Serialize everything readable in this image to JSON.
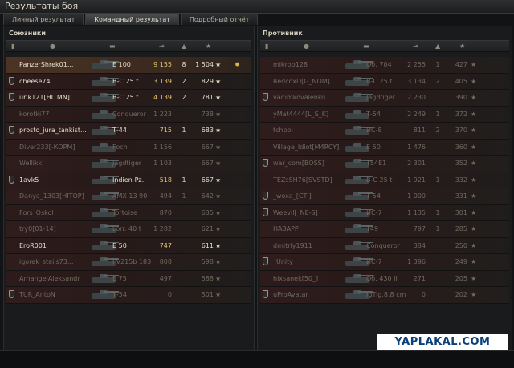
{
  "window": {
    "title": "Результаты боя"
  },
  "tabs": [
    {
      "label": "Личный результат",
      "active": false
    },
    {
      "label": "Командный результат",
      "active": true
    },
    {
      "label": "Подробный отчёт",
      "active": false
    }
  ],
  "allies": {
    "title": "Союзники",
    "columns": {
      "platoon": "platoon-icon",
      "player": "player-icon",
      "tank": "tank-icon",
      "damage": "damage-icon",
      "frags": "frags-icon",
      "xp": "★"
    },
    "rows": [
      {
        "player": "PanzerShrek01...",
        "tank": "E 100",
        "damage": "9 155",
        "frags": "8",
        "xp": "1 504",
        "alive": true,
        "platoon": false,
        "highlight": true,
        "medal": true
      },
      {
        "player": "cheese74",
        "tank": "В-С 25 t",
        "damage": "3 139",
        "frags": "2",
        "xp": "829",
        "alive": true,
        "platoon": true
      },
      {
        "player": "urik121[HITMN]",
        "tank": "В-С 25 t",
        "damage": "4 139",
        "frags": "2",
        "xp": "781",
        "alive": true,
        "platoon": true
      },
      {
        "player": "korotki77",
        "tank": "Conqueror",
        "damage": "1 223",
        "frags": "",
        "xp": "738",
        "alive": false,
        "platoon": false
      },
      {
        "player": "prosto_jura_tankist...",
        "tank": "Т-44",
        "damage": "715",
        "frags": "1",
        "xp": "683",
        "alive": true,
        "platoon": true
      },
      {
        "player": "Diver233[-КОРМ]",
        "tank": "Foch",
        "damage": "1 156",
        "frags": "",
        "xp": "667",
        "alive": false,
        "platoon": false
      },
      {
        "player": "Wellikk",
        "tank": "Jagdtiger",
        "damage": "1 103",
        "frags": "",
        "xp": "667",
        "alive": false,
        "platoon": false
      },
      {
        "player": "1avk5",
        "tank": "Indien-Pz.",
        "damage": "518",
        "frags": "1",
        "xp": "667",
        "alive": true,
        "platoon": true
      },
      {
        "player": "Danya_1303[HITOP]",
        "tank": "AMX 13 90",
        "damage": "494",
        "frags": "1",
        "xp": "642",
        "alive": false,
        "platoon": false
      },
      {
        "player": "Fors_Oskol",
        "tank": "Tortoise",
        "damage": "870",
        "frags": "",
        "xp": "635",
        "alive": false,
        "platoon": false
      },
      {
        "player": "try0[01-14]",
        "tank": "Lorr. 40 t",
        "damage": "1 282",
        "frags": "",
        "xp": "621",
        "alive": false,
        "platoon": false
      },
      {
        "player": "EroR001",
        "tank": "E 50",
        "damage": "747",
        "frags": "",
        "xp": "611",
        "alive": true,
        "platoon": false
      },
      {
        "player": "igorek_stails73...",
        "tank": "FV215b 183",
        "damage": "808",
        "frags": "",
        "xp": "598",
        "alive": false,
        "platoon": false
      },
      {
        "player": "ArhangelAleksandr",
        "tank": "E 75",
        "damage": "497",
        "frags": "",
        "xp": "588",
        "alive": false,
        "platoon": false
      },
      {
        "player": "TUR_AntoN",
        "tank": "Т-54",
        "damage": "0",
        "frags": "",
        "xp": "501",
        "alive": false,
        "platoon": true
      }
    ]
  },
  "enemies": {
    "title": "Противник",
    "rows": [
      {
        "player": "mikrob128",
        "tank": "Об. 704",
        "damage": "2 255",
        "frags": "1",
        "xp": "427",
        "alive": false,
        "platoon": false
      },
      {
        "player": "RedcoxD[G_NOM]",
        "tank": "В-С 25 t",
        "damage": "3 134",
        "frags": "2",
        "xp": "405",
        "alive": false,
        "platoon": false
      },
      {
        "player": "vadimkovalenko",
        "tank": "Jagdtiger",
        "damage": "2 230",
        "frags": "",
        "xp": "390",
        "alive": false,
        "platoon": true
      },
      {
        "player": "yMat4444[L_S_K]",
        "tank": "Т-54",
        "damage": "2 249",
        "frags": "1",
        "xp": "372",
        "alive": false,
        "platoon": false
      },
      {
        "player": "tchpol",
        "tank": "ИС-8",
        "damage": "811",
        "frags": "2",
        "xp": "370",
        "alive": false,
        "platoon": false
      },
      {
        "player": "Village_Idiot[M4RCY]",
        "tank": "E 50",
        "damage": "1 476",
        "frags": "",
        "xp": "360",
        "alive": false,
        "platoon": false
      },
      {
        "player": "war_com[BOSS]",
        "tank": "T54E1",
        "damage": "2 301",
        "frags": "",
        "xp": "352",
        "alive": false,
        "platoon": true
      },
      {
        "player": "TEZsSH76[SVSTD]",
        "tank": "В-С 25 t",
        "damage": "1 921",
        "frags": "1",
        "xp": "332",
        "alive": false,
        "platoon": false
      },
      {
        "player": "_woxa_[CT-]",
        "tank": "Т-54",
        "damage": "1 000",
        "frags": "",
        "xp": "331",
        "alive": false,
        "platoon": true
      },
      {
        "player": "Weevil[_NE-S]",
        "tank": "ИС-7",
        "damage": "1 135",
        "frags": "1",
        "xp": "301",
        "alive": false,
        "platoon": true
      },
      {
        "player": "НАЗАРР",
        "tank": "Т49",
        "damage": "797",
        "frags": "1",
        "xp": "285",
        "alive": false,
        "platoon": false
      },
      {
        "player": "dmitriy1911",
        "tank": "Conqueror",
        "damage": "384",
        "frags": "",
        "xp": "250",
        "alive": false,
        "platoon": false
      },
      {
        "player": "_Unity",
        "tank": "ИС-7",
        "damage": "1 396",
        "frags": "",
        "xp": "249",
        "alive": false,
        "platoon": true
      },
      {
        "player": "hixsanek[50_]",
        "tank": "Об. 430 II",
        "damage": "271",
        "frags": "",
        "xp": "205",
        "alive": false,
        "platoon": false
      },
      {
        "player": "uProAvatar",
        "tank": "JgTig.8,8 cm",
        "damage": "0",
        "frags": "",
        "xp": "202",
        "alive": false,
        "platoon": true
      }
    ]
  },
  "watermark": "YAPLAKAL.COM"
}
